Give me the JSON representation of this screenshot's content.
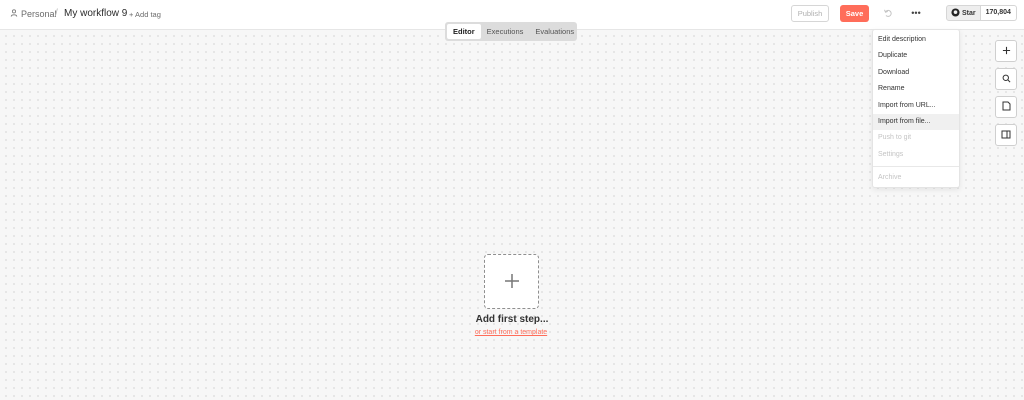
{
  "header": {
    "breadcrumb_personal": "Personal",
    "breadcrumb_sep": "/",
    "workflow_name": "My workflow 9",
    "add_tag": "+ Add tag",
    "publish_label": "Publish",
    "save_label": "Save",
    "more_label": "•••",
    "github_star": "Star",
    "github_count": "170,804"
  },
  "tabs": [
    {
      "label": "Editor",
      "active": true
    },
    {
      "label": "Executions",
      "active": false
    },
    {
      "label": "Evaluations",
      "active": false
    }
  ],
  "menu": {
    "items": [
      {
        "label": "Edit description",
        "disabled": false
      },
      {
        "label": "Duplicate",
        "disabled": false
      },
      {
        "label": "Download",
        "disabled": false
      },
      {
        "label": "Rename",
        "disabled": false
      },
      {
        "label": "Import from URL...",
        "disabled": false
      },
      {
        "label": "Import from file...",
        "disabled": false
      },
      {
        "label": "Push to git",
        "disabled": true
      },
      {
        "label": "Settings",
        "disabled": true
      },
      {
        "label": "Archive",
        "disabled": true
      }
    ]
  },
  "canvas": {
    "add_first_step": "Add first step...",
    "template_link": "or start from a template"
  },
  "side_icons": [
    "plus-icon",
    "search-icon",
    "sticky-note-icon",
    "panel-icon"
  ],
  "colors": {
    "accent": "#ff6d5a",
    "canvas_bg": "#f7f7f7"
  }
}
